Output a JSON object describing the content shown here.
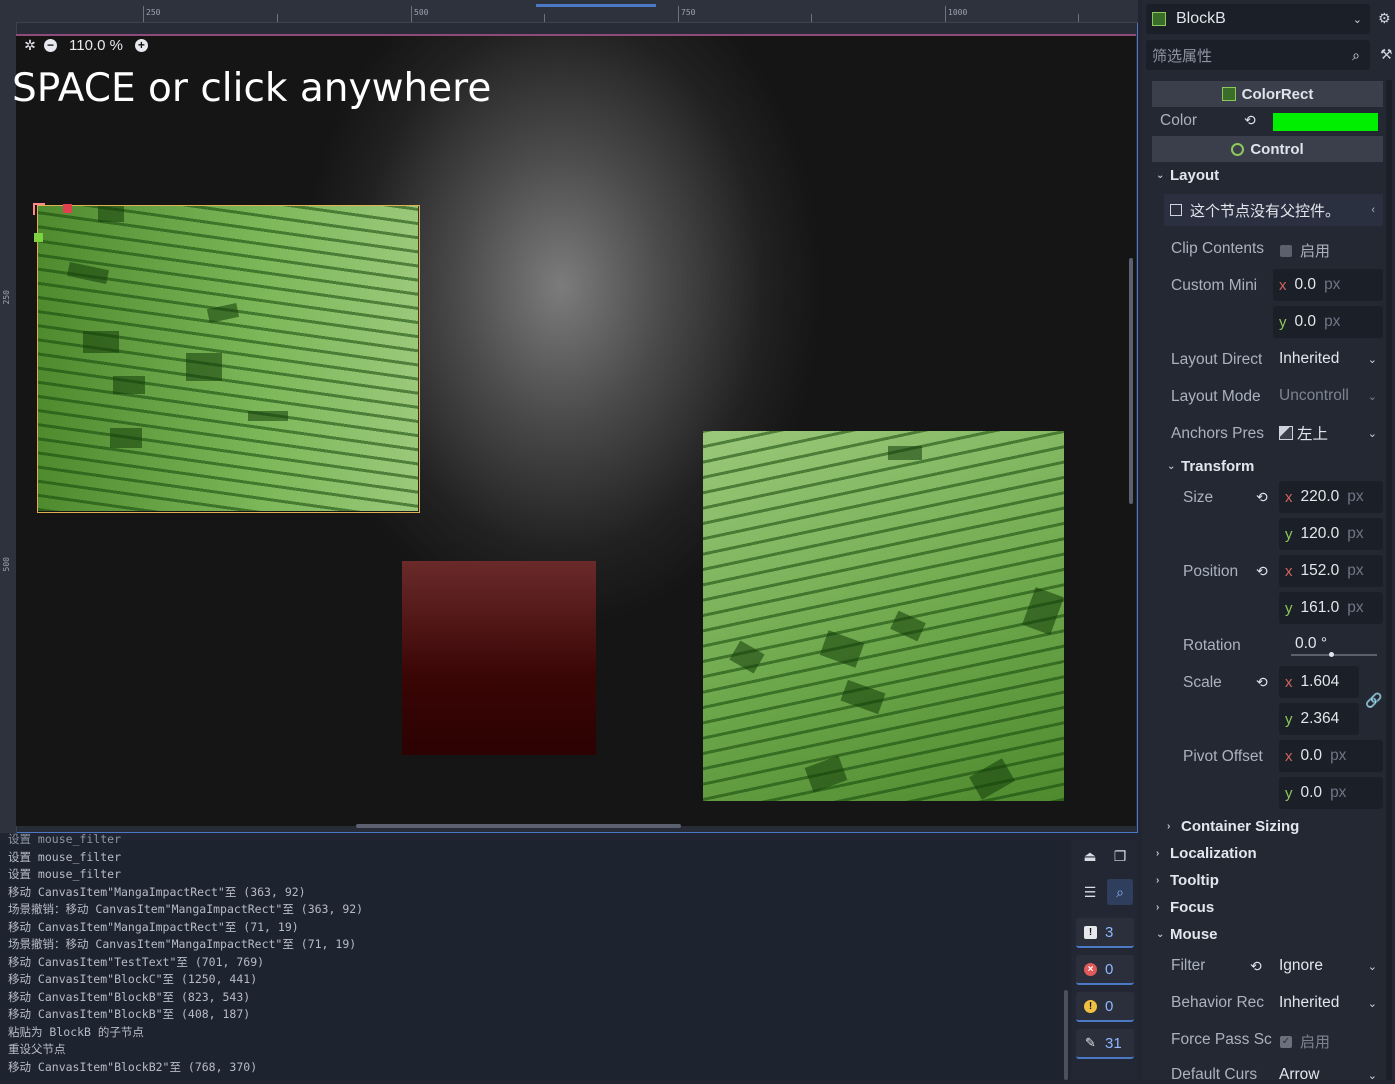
{
  "viewport": {
    "ruler_labels": [
      "250",
      "500",
      "750",
      "1000"
    ],
    "left_ruler_labels": [
      "250",
      "500"
    ],
    "zoom": "110.0 %",
    "canvas_text": "SPACE or click anywhere"
  },
  "log": {
    "lines": [
      "设置 mouse_filter",
      "设置 mouse_filter",
      "设置 mouse_filter",
      "移动 CanvasItem\"MangaImpactRect\"至 (363, 92)",
      "场景撤销：移动 CanvasItem\"MangaImpactRect\"至 (363, 92)",
      "移动 CanvasItem\"MangaImpactRect\"至 (71, 19)",
      "场景撤销：移动 CanvasItem\"MangaImpactRect\"至 (71, 19)",
      "移动 CanvasItem\"TestText\"至 (701, 769)",
      "移动 CanvasItem\"BlockC\"至 (1250, 441)",
      "移动 CanvasItem\"BlockB\"至 (823, 543)",
      "移动 CanvasItem\"BlockB\"至 (408, 187)",
      "粘贴为 BlockB 的子节点",
      "重设父节点",
      "移动 CanvasItem\"BlockB2\"至 (768, 370)"
    ],
    "counters": {
      "messages": "3",
      "errors": "0",
      "warnings": "0",
      "editor": "31"
    }
  },
  "inspector": {
    "node_name": "BlockB",
    "filter_placeholder": "筛选属性",
    "colorrect_header": "ColorRect",
    "color_label": "Color",
    "color_value": "#00ee00",
    "control_header": "Control",
    "layout_group": "Layout",
    "layout_notice": "这个节点没有父控件。",
    "clip_contents_label": "Clip Contents",
    "clip_contents_value": "启用",
    "custom_min_label": "Custom Mini",
    "custom_min_x": "0.0",
    "custom_min_y": "0.0",
    "unit_px": "px",
    "layout_direction_label": "Layout Direct",
    "layout_direction_value": "Inherited",
    "layout_mode_label": "Layout Mode",
    "layout_mode_value": "Uncontroll",
    "anchors_label": "Anchors Pres",
    "anchors_value": "左上",
    "transform_group": "Transform",
    "size_label": "Size",
    "size_x": "220.0",
    "size_y": "120.0",
    "position_label": "Position",
    "position_x": "152.0",
    "position_y": "161.0",
    "rotation_label": "Rotation",
    "rotation_value": "0.0 °",
    "scale_label": "Scale",
    "scale_x": "1.604",
    "scale_y": "2.364",
    "pivot_label": "Pivot Offset",
    "pivot_x": "0.0",
    "pivot_y": "0.0",
    "container_sizing": "Container Sizing",
    "localization": "Localization",
    "tooltip": "Tooltip",
    "focus": "Focus",
    "mouse": "Mouse",
    "filter_label": "Filter",
    "filter_value": "Ignore",
    "behavior_label": "Behavior Rec",
    "behavior_value": "Inherited",
    "force_pass_label": "Force Pass Sc",
    "force_pass_value": "启用",
    "default_cursor_label": "Default Curs",
    "default_cursor_value": "Arrow"
  },
  "colors": {
    "accent": "#4b79c6",
    "color_swatch": "#00ee00",
    "axis_x": "#d2655f",
    "axis_y": "#8dc95a"
  }
}
